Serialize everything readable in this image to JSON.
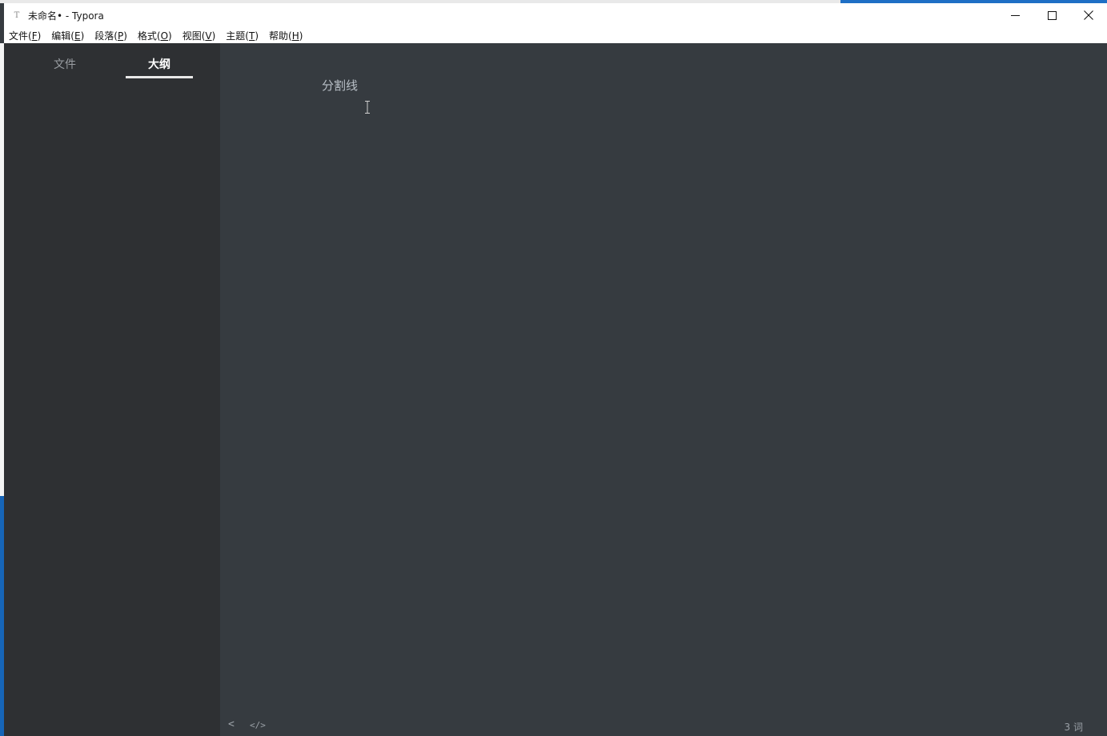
{
  "window": {
    "title": "未命名• - Typora",
    "app_icon_glyph": "T"
  },
  "menubar": {
    "items": [
      {
        "label": "文件(",
        "key": "F",
        "end": ")"
      },
      {
        "label": "编辑(",
        "key": "E",
        "end": ")"
      },
      {
        "label": "段落(",
        "key": "P",
        "end": ")"
      },
      {
        "label": "格式(",
        "key": "O",
        "end": ")"
      },
      {
        "label": "视图(",
        "key": "V",
        "end": ")"
      },
      {
        "label": "主题(",
        "key": "T",
        "end": ")"
      },
      {
        "label": "帮助(",
        "key": "H",
        "end": ")"
      }
    ]
  },
  "sidebar": {
    "tabs": [
      {
        "label": "文件",
        "active": false
      },
      {
        "label": "大纲",
        "active": true
      }
    ]
  },
  "editor": {
    "content_line": "分割线"
  },
  "statusbar": {
    "back_glyph": "<",
    "source_glyph": "</>",
    "word_count": "3 词"
  },
  "colors": {
    "editor_bg": "#363b40",
    "sidebar_bg": "#2e3033",
    "text": "#b8bfc6",
    "active_tab": "#ffffff",
    "inactive_tab": "#9a9ea3"
  }
}
